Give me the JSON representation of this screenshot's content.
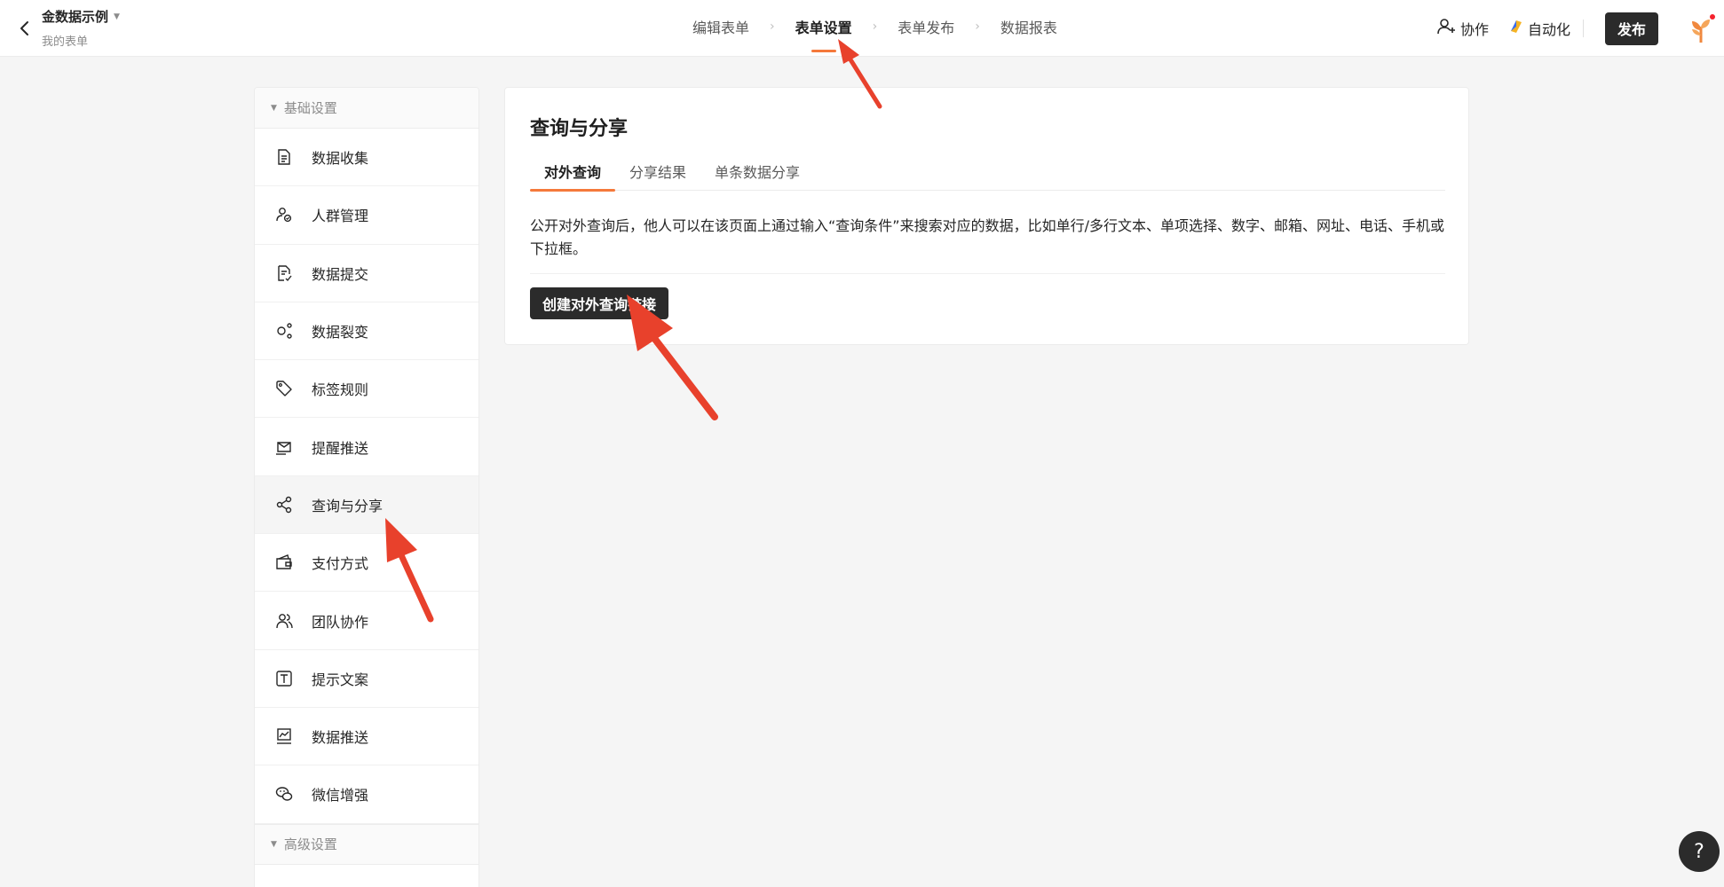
{
  "header": {
    "form_title": "金数据示例",
    "form_subtitle": "我的表单",
    "steps": [
      "编辑表单",
      "表单设置",
      "表单发布",
      "数据报表"
    ],
    "active_step": 1,
    "collab_label": "协作",
    "automation_label": "自动化",
    "publish_label": "发布"
  },
  "sidebar": {
    "basic_group": "基础设置",
    "items": [
      {
        "label": "数据收集",
        "icon": "document-icon"
      },
      {
        "label": "人群管理",
        "icon": "user-group-icon"
      },
      {
        "label": "数据提交",
        "icon": "submit-document-icon"
      },
      {
        "label": "数据裂变",
        "icon": "fission-icon"
      },
      {
        "label": "标签规则",
        "icon": "tag-icon"
      },
      {
        "label": "提醒推送",
        "icon": "notification-icon"
      },
      {
        "label": "查询与分享",
        "icon": "share-icon"
      },
      {
        "label": "支付方式",
        "icon": "wallet-icon"
      },
      {
        "label": "团队协作",
        "icon": "team-icon"
      },
      {
        "label": "提示文案",
        "icon": "text-icon"
      },
      {
        "label": "数据推送",
        "icon": "chart-push-icon"
      },
      {
        "label": "微信增强",
        "icon": "wechat-icon"
      }
    ],
    "active_index": 6,
    "advanced_group": "高级设置"
  },
  "main": {
    "title": "查询与分享",
    "tabs": [
      "对外查询",
      "分享结果",
      "单条数据分享"
    ],
    "active_tab": 0,
    "description": "公开对外查询后，他人可以在该页面上通过输入“查询条件”来搜索对应的数据，比如单行/多行文本、单项选择、数字、邮箱、网址、电话、手机或下拉框。",
    "create_button": "创建对外查询链接"
  },
  "help": {
    "label": "?"
  },
  "colors": {
    "accent": "#f5793b",
    "dark_button": "#2b2b2b",
    "annotation_arrow": "#e8412c"
  }
}
